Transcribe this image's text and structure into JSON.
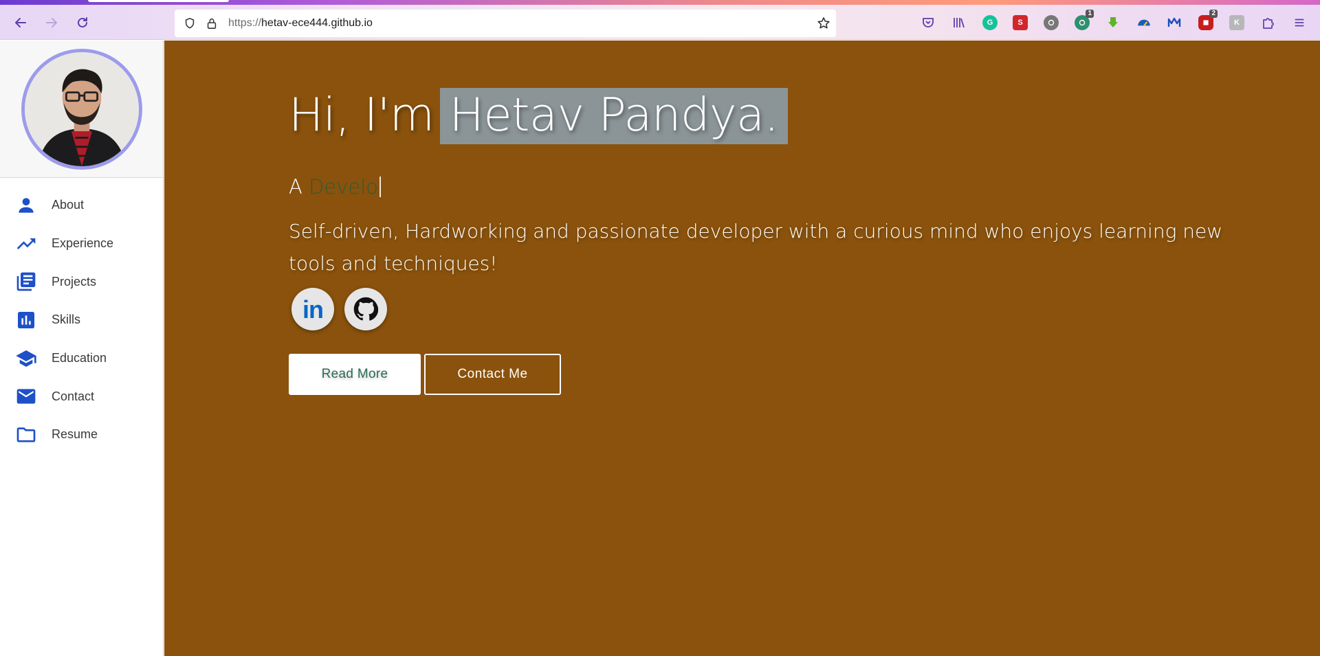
{
  "browser": {
    "url_scheme": "https://",
    "url_host": "hetav-ece444.github.io",
    "extensions": [
      {
        "name": "pocket-icon",
        "color": "#5b3fa8"
      },
      {
        "name": "library-icon",
        "color": "#5b3fa8"
      },
      {
        "name": "grammarly-icon",
        "color": "#15c39a"
      },
      {
        "name": "s-extension-icon",
        "color": "#d3262b",
        "label": "S"
      },
      {
        "name": "privacy-icon",
        "color": "#777777"
      },
      {
        "name": "sync-icon",
        "color": "#2f8f6f",
        "badge": "1"
      },
      {
        "name": "download-icon",
        "color": "#5fb32b"
      },
      {
        "name": "speed-icon",
        "color": "#1d5db3"
      },
      {
        "name": "malwarebytes-icon",
        "color": "#1c4fb8"
      },
      {
        "name": "ublock-icon",
        "color": "#c81d1d",
        "badge": "2"
      },
      {
        "name": "extension-k-icon",
        "color": "#b7b7b7"
      },
      {
        "name": "puzzle-icon",
        "color": "#5b3fa8"
      },
      {
        "name": "menu-icon",
        "color": "#5b3fa8"
      }
    ]
  },
  "sidebar": {
    "items": [
      {
        "label": "About",
        "icon": "person-icon"
      },
      {
        "label": "Experience",
        "icon": "trending-up-icon"
      },
      {
        "label": "Projects",
        "icon": "library-books-icon"
      },
      {
        "label": "Skills",
        "icon": "bar-chart-icon"
      },
      {
        "label": "Education",
        "icon": "school-icon"
      },
      {
        "label": "Contact",
        "icon": "mail-icon"
      },
      {
        "label": "Resume",
        "icon": "folder-icon"
      }
    ]
  },
  "hero": {
    "greeting": "Hi, I'm",
    "name": "Hetav Pandya.",
    "typed_prefix": "A",
    "typed_text": "Develo",
    "description": "Self-driven, Hardworking and passionate developer with a curious mind who enjoys learning new tools and techniques!",
    "linkedin_label": "in",
    "read_more": "Read More",
    "contact_me": "Contact Me"
  },
  "colors": {
    "hero_background": "#8a520c",
    "accent_icon": "#1e50c8",
    "name_highlight": "#8b9598"
  }
}
